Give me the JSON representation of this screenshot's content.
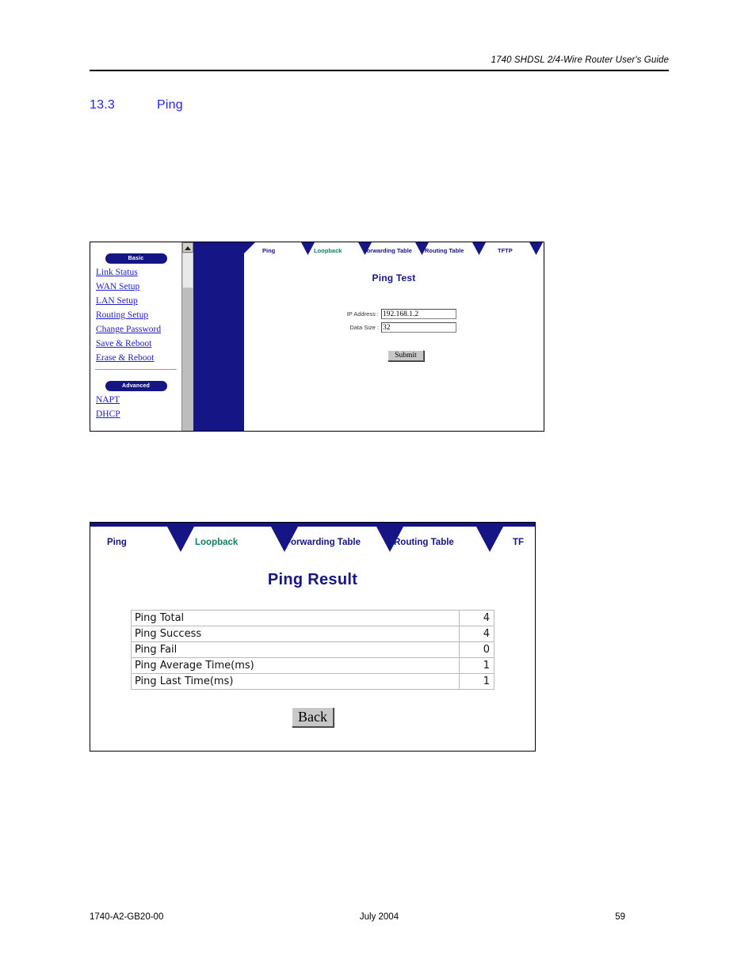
{
  "page": {
    "header_title": "1740 SHDSL 2/4-Wire Router User's Guide",
    "section_number": "13.3",
    "section_title": "Ping",
    "footer_doc_id": "1740-A2-GB20-00",
    "footer_date": "July 2004",
    "footer_page": "59",
    "colors": {
      "navy": "#151585",
      "heading_blue": "#2222ee",
      "link_blue": "#2020c0",
      "active_tab_green": "#108060"
    }
  },
  "figure1": {
    "sidebar": {
      "basic_pill": "Basic",
      "basic_links": [
        "Link Status",
        "WAN Setup",
        "LAN Setup",
        "Routing Setup",
        "Change Password",
        "Save & Reboot",
        "Erase & Reboot"
      ],
      "advanced_pill": "Advanced",
      "advanced_links": [
        "NAPT",
        "DHCP"
      ]
    },
    "tabs": [
      {
        "label": "Ping",
        "state": "normal"
      },
      {
        "label": "Loopback",
        "state": "green"
      },
      {
        "label": "Forwarding Table",
        "state": "normal"
      },
      {
        "label": "Routing Table",
        "state": "normal"
      },
      {
        "label": "TFTP",
        "state": "normal"
      }
    ],
    "panel_title": "Ping Test",
    "form": {
      "ip_label": "IP Address :",
      "ip_value": "192.168.1.2",
      "size_label": "Data Size :",
      "size_value": "32",
      "submit_label": "Submit"
    }
  },
  "figure2": {
    "tabs": [
      {
        "label": "Ping",
        "state": "normal"
      },
      {
        "label": "Loopback",
        "state": "green"
      },
      {
        "label": "Forwarding Table",
        "state": "normal"
      },
      {
        "label": "Routing Table",
        "state": "normal"
      },
      {
        "label": "TF",
        "state": "normal"
      }
    ],
    "panel_title": "Ping Result",
    "rows": [
      {
        "label": "Ping Total",
        "value": "4"
      },
      {
        "label": "Ping Success",
        "value": "4"
      },
      {
        "label": "Ping Fail",
        "value": "0"
      },
      {
        "label": "Ping Average Time(ms)",
        "value": "1"
      },
      {
        "label": "Ping Last Time(ms)",
        "value": "1"
      }
    ],
    "back_label": "Back"
  }
}
